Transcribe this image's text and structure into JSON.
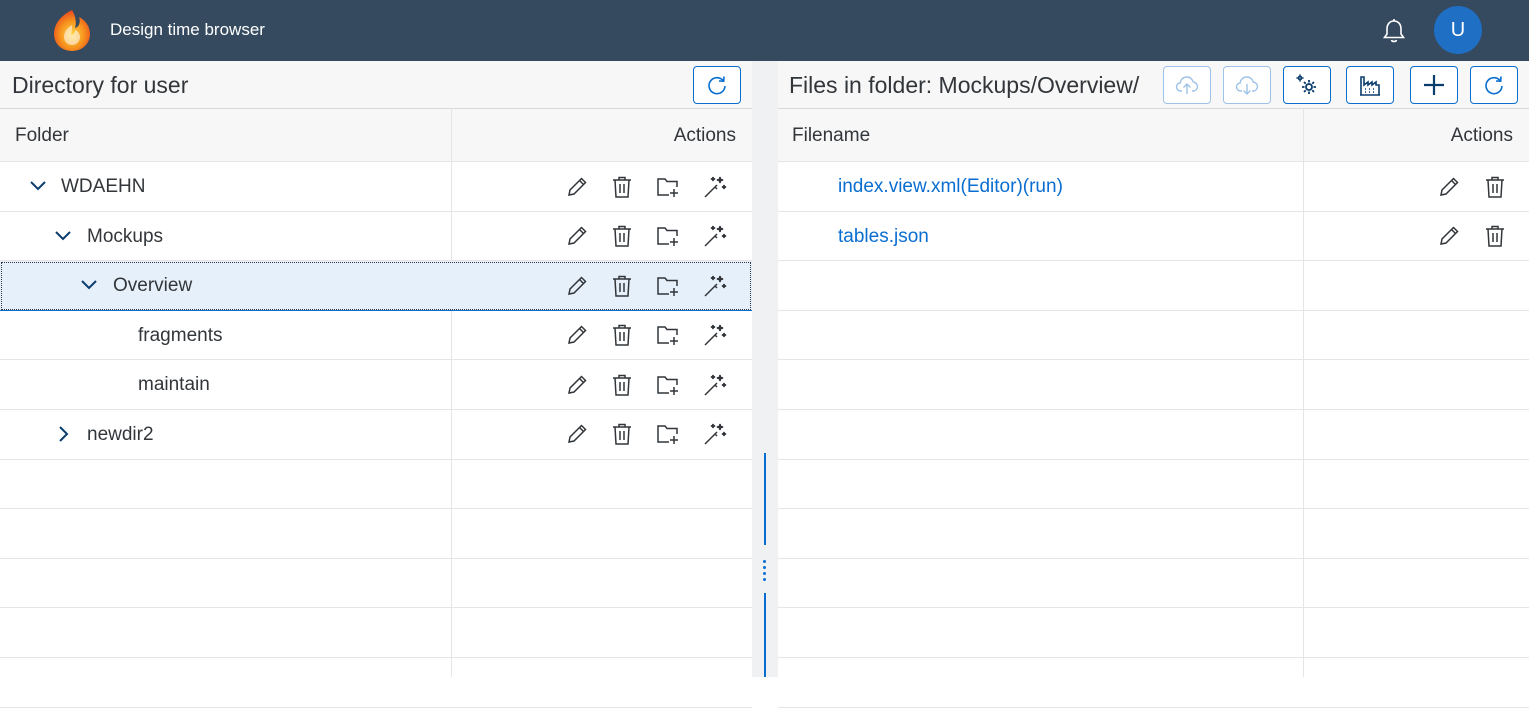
{
  "shell": {
    "app_title": "Design time browser",
    "avatar_initial": "U",
    "logo_icon": "flame-logo-icon",
    "notification_icon": "bell-icon"
  },
  "left_panel": {
    "title": "Directory for user",
    "refresh_icon": "refresh-icon",
    "columns": {
      "folder": "Folder",
      "actions": "Actions"
    },
    "folders": [
      {
        "name": "WDAEHN",
        "level": 0,
        "expanded": true,
        "selected": false
      },
      {
        "name": "Mockups",
        "level": 1,
        "expanded": true,
        "selected": false
      },
      {
        "name": "Overview",
        "level": 2,
        "expanded": true,
        "selected": true
      },
      {
        "name": "fragments",
        "level": 3,
        "expanded": null,
        "selected": false
      },
      {
        "name": "maintain",
        "level": 3,
        "expanded": null,
        "selected": false
      },
      {
        "name": "newdir2",
        "level": 1,
        "expanded": false,
        "selected": false
      }
    ],
    "row_action_icons": [
      "edit-icon",
      "delete-icon",
      "add-folder-icon",
      "wizard-icon"
    ]
  },
  "right_panel": {
    "title": "Files in folder: Mockups/Overview/",
    "toolbar_icons": [
      "upload-icon",
      "download-icon",
      "settings-icon",
      "factory-icon",
      "add-icon",
      "refresh-icon"
    ],
    "columns": {
      "filename": "Filename",
      "actions": "Actions"
    },
    "files": [
      {
        "name": "index.view.xml(Editor)(run)"
      },
      {
        "name": "tables.json"
      }
    ],
    "row_action_icons": [
      "edit-icon",
      "delete-icon"
    ]
  },
  "colors": {
    "shell": "#354a5f",
    "accent": "#0a6ed1",
    "selected_row": "#e5f0fa"
  }
}
